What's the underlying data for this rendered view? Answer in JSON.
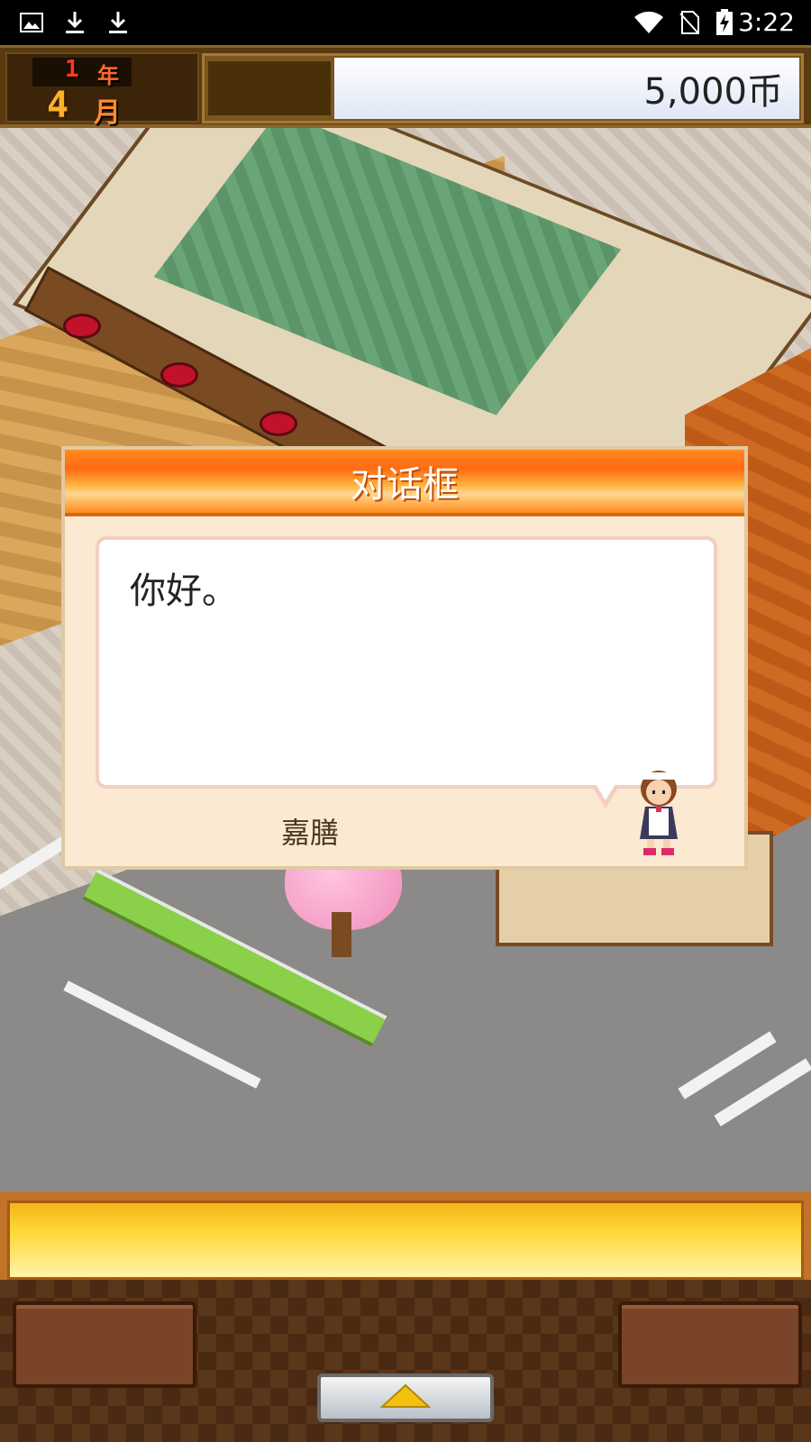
{
  "status_bar": {
    "icons": [
      "image-icon",
      "download-icon",
      "download-icon",
      "wifi-icon",
      "no-sim-icon",
      "battery-charging-icon"
    ],
    "time": "3:22"
  },
  "hud": {
    "year_num": "1",
    "year_unit": "年",
    "month_num": "4",
    "month_unit": "月",
    "money": "5,000币"
  },
  "dialog": {
    "title": "对话框",
    "message": "你好。",
    "speaker": "嘉膳",
    "avatar_icon": "maid-character-icon"
  },
  "bottom": {
    "up_icon": "triangle-up-icon"
  },
  "colors": {
    "dialog_title": "#ff7a18",
    "dialog_bg": "#fbe9d1",
    "hud_bg": "#5a3a10"
  }
}
